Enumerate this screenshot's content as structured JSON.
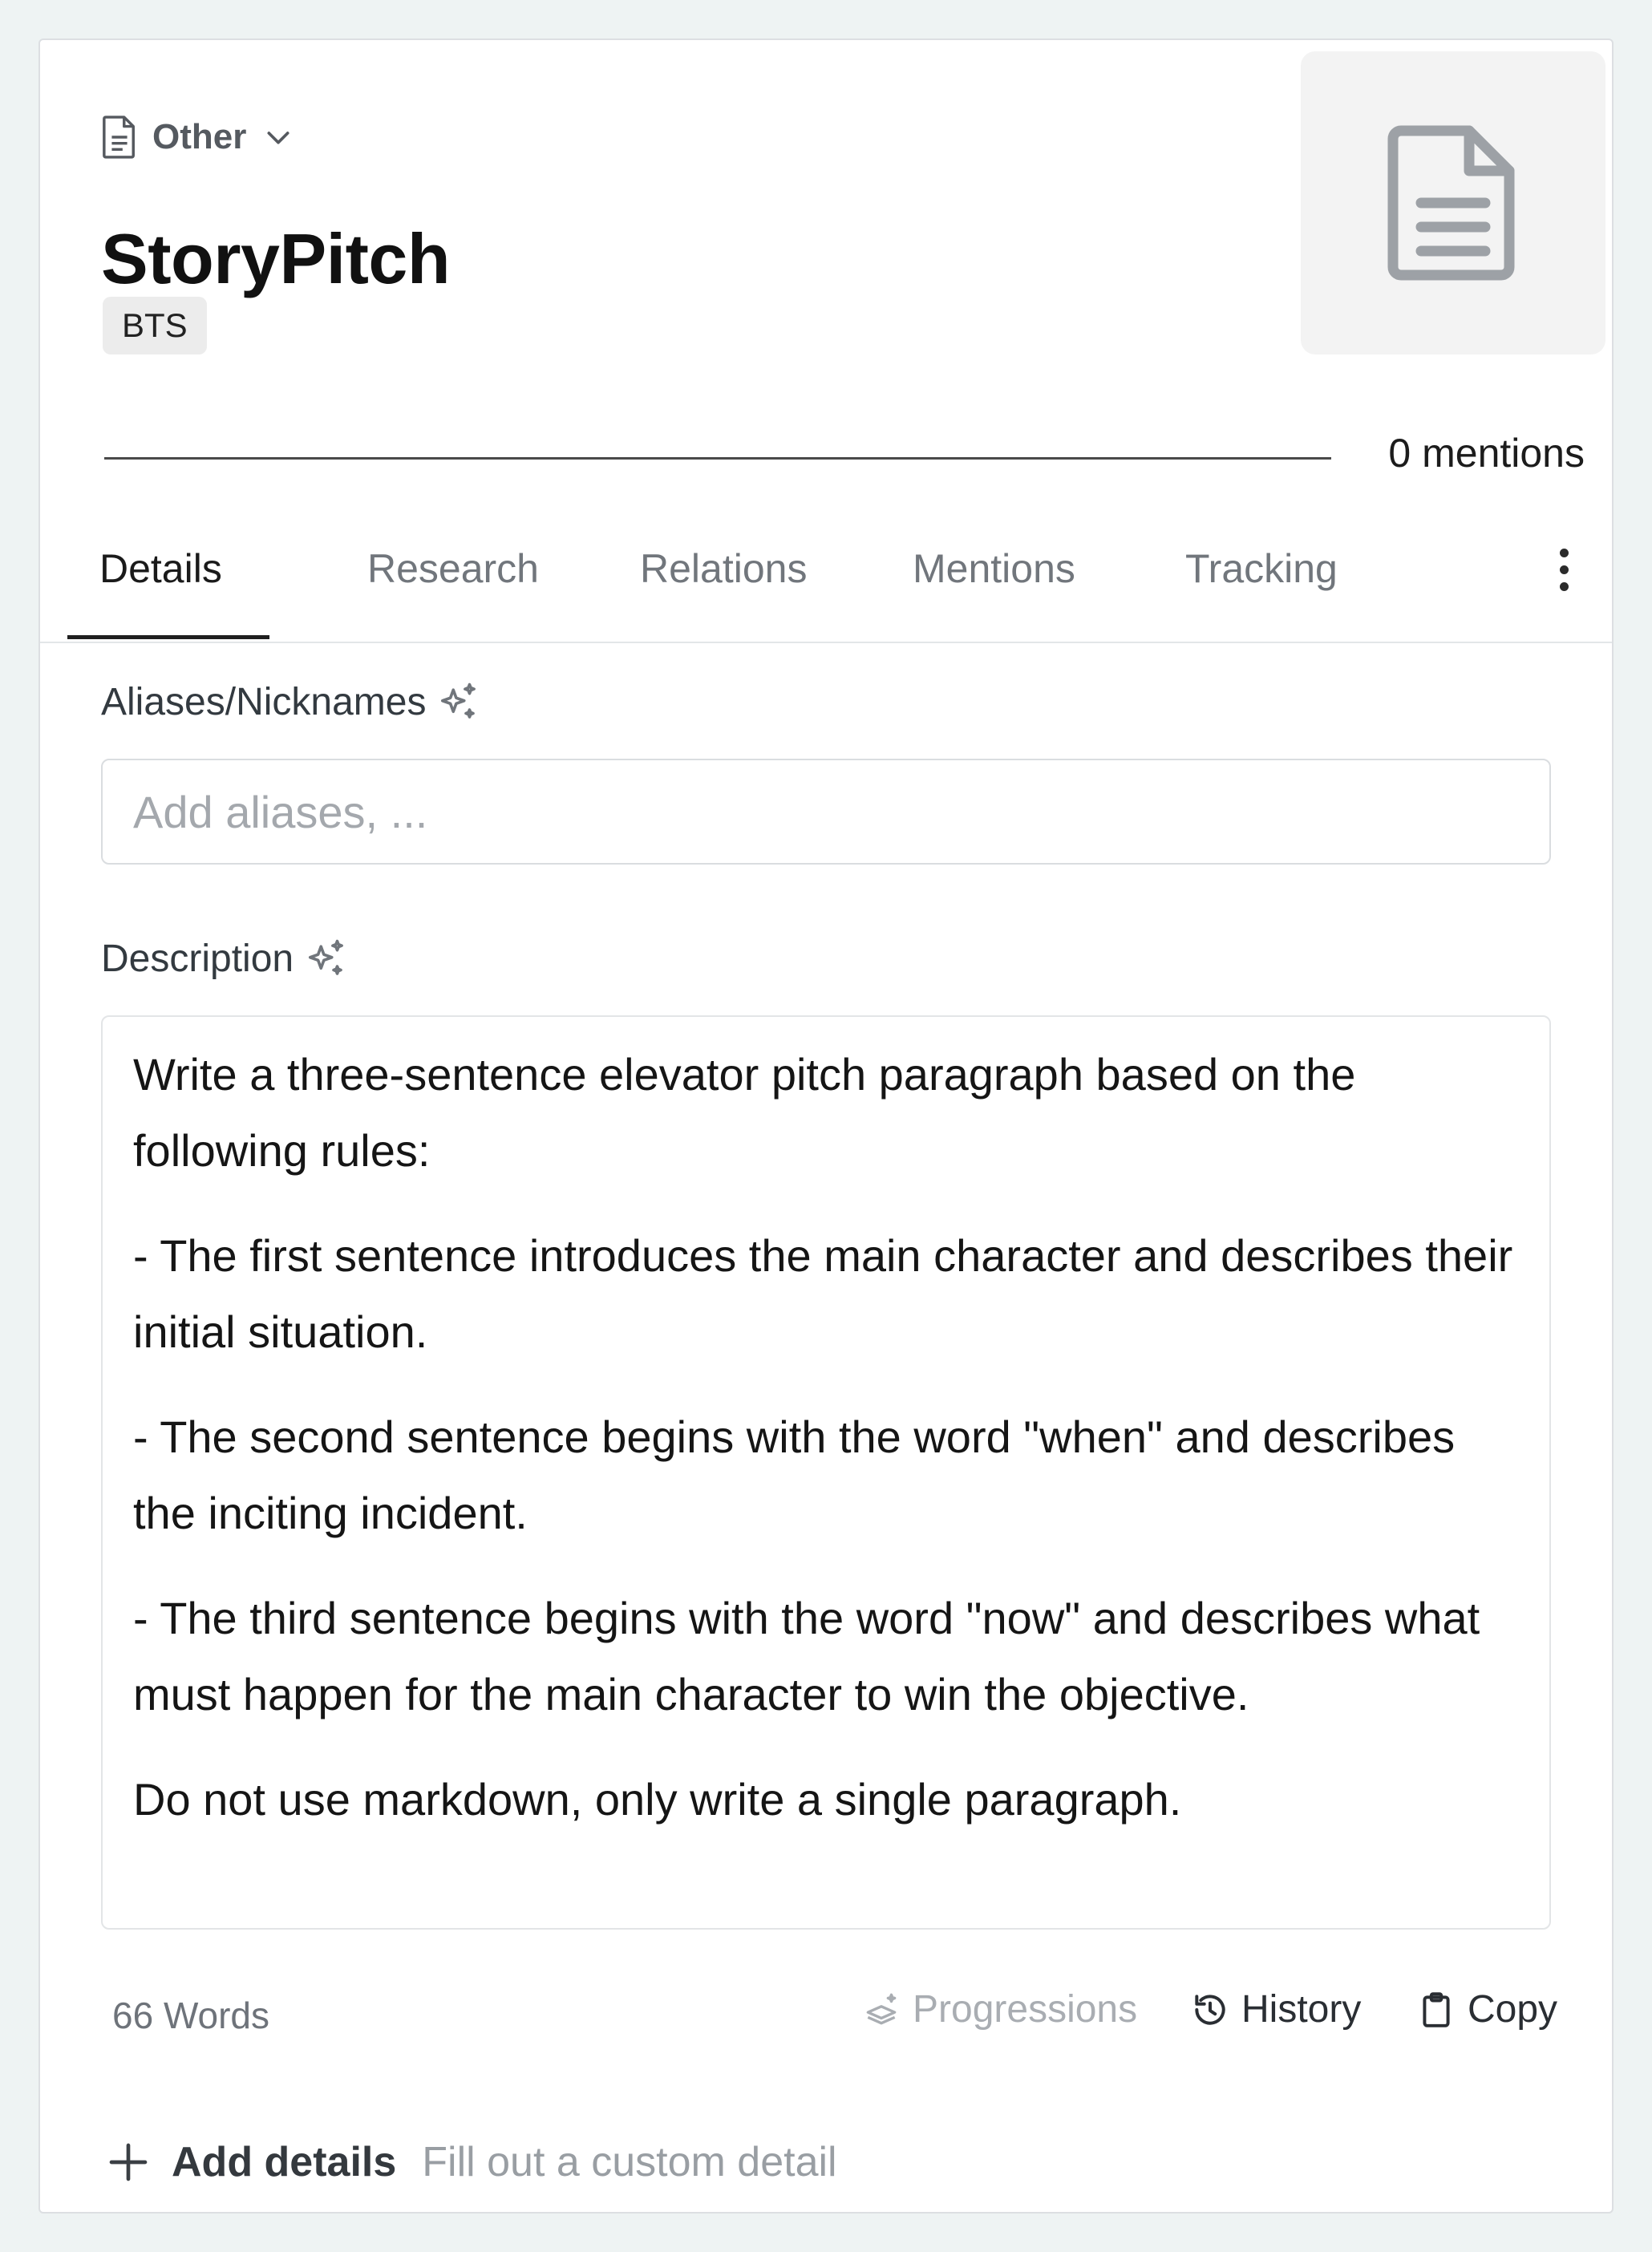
{
  "header": {
    "type_label": "Other",
    "title": "StoryPitch",
    "tag": "BTS",
    "mentions": "0 mentions"
  },
  "tabs": [
    {
      "label": "Details",
      "active": true
    },
    {
      "label": "Research",
      "active": false
    },
    {
      "label": "Relations",
      "active": false
    },
    {
      "label": "Mentions",
      "active": false
    },
    {
      "label": "Tracking",
      "active": false
    }
  ],
  "aliases": {
    "label": "Aliases/Nicknames",
    "placeholder": "Add aliases, ...",
    "value": ""
  },
  "description": {
    "label": "Description",
    "paragraphs": [
      "Write a three-sentence elevator pitch paragraph based on the following rules:",
      "- The first sentence introduces the main character and describes their initial situation.",
      "- The second sentence begins with the word \"when\" and describes the inciting incident.",
      "- The third sentence begins with the word \"now\" and describes what must happen for the main character to win the objective.",
      "Do not use markdown, only write a single paragraph."
    ],
    "word_count": "66 Words"
  },
  "footer_actions": {
    "progressions": "Progressions",
    "history": "History",
    "copy": "Copy"
  },
  "add_details": {
    "label": "Add details",
    "hint": "Fill out a custom detail"
  },
  "colors": {
    "background": "#eef3f3",
    "card": "#ffffff",
    "active_tab": "#1a1a1a",
    "inactive_tab": "#71767c",
    "disabled": "#a9adb2"
  },
  "icons": {
    "type": "document-icon",
    "type_dropdown": "chevron-down-icon",
    "thumbnail": "document-icon",
    "more": "kebab-menu-icon",
    "ai": "sparkle-icon",
    "progressions": "layers-icon",
    "history": "history-icon",
    "copy": "clipboard-icon",
    "add": "plus-icon"
  }
}
